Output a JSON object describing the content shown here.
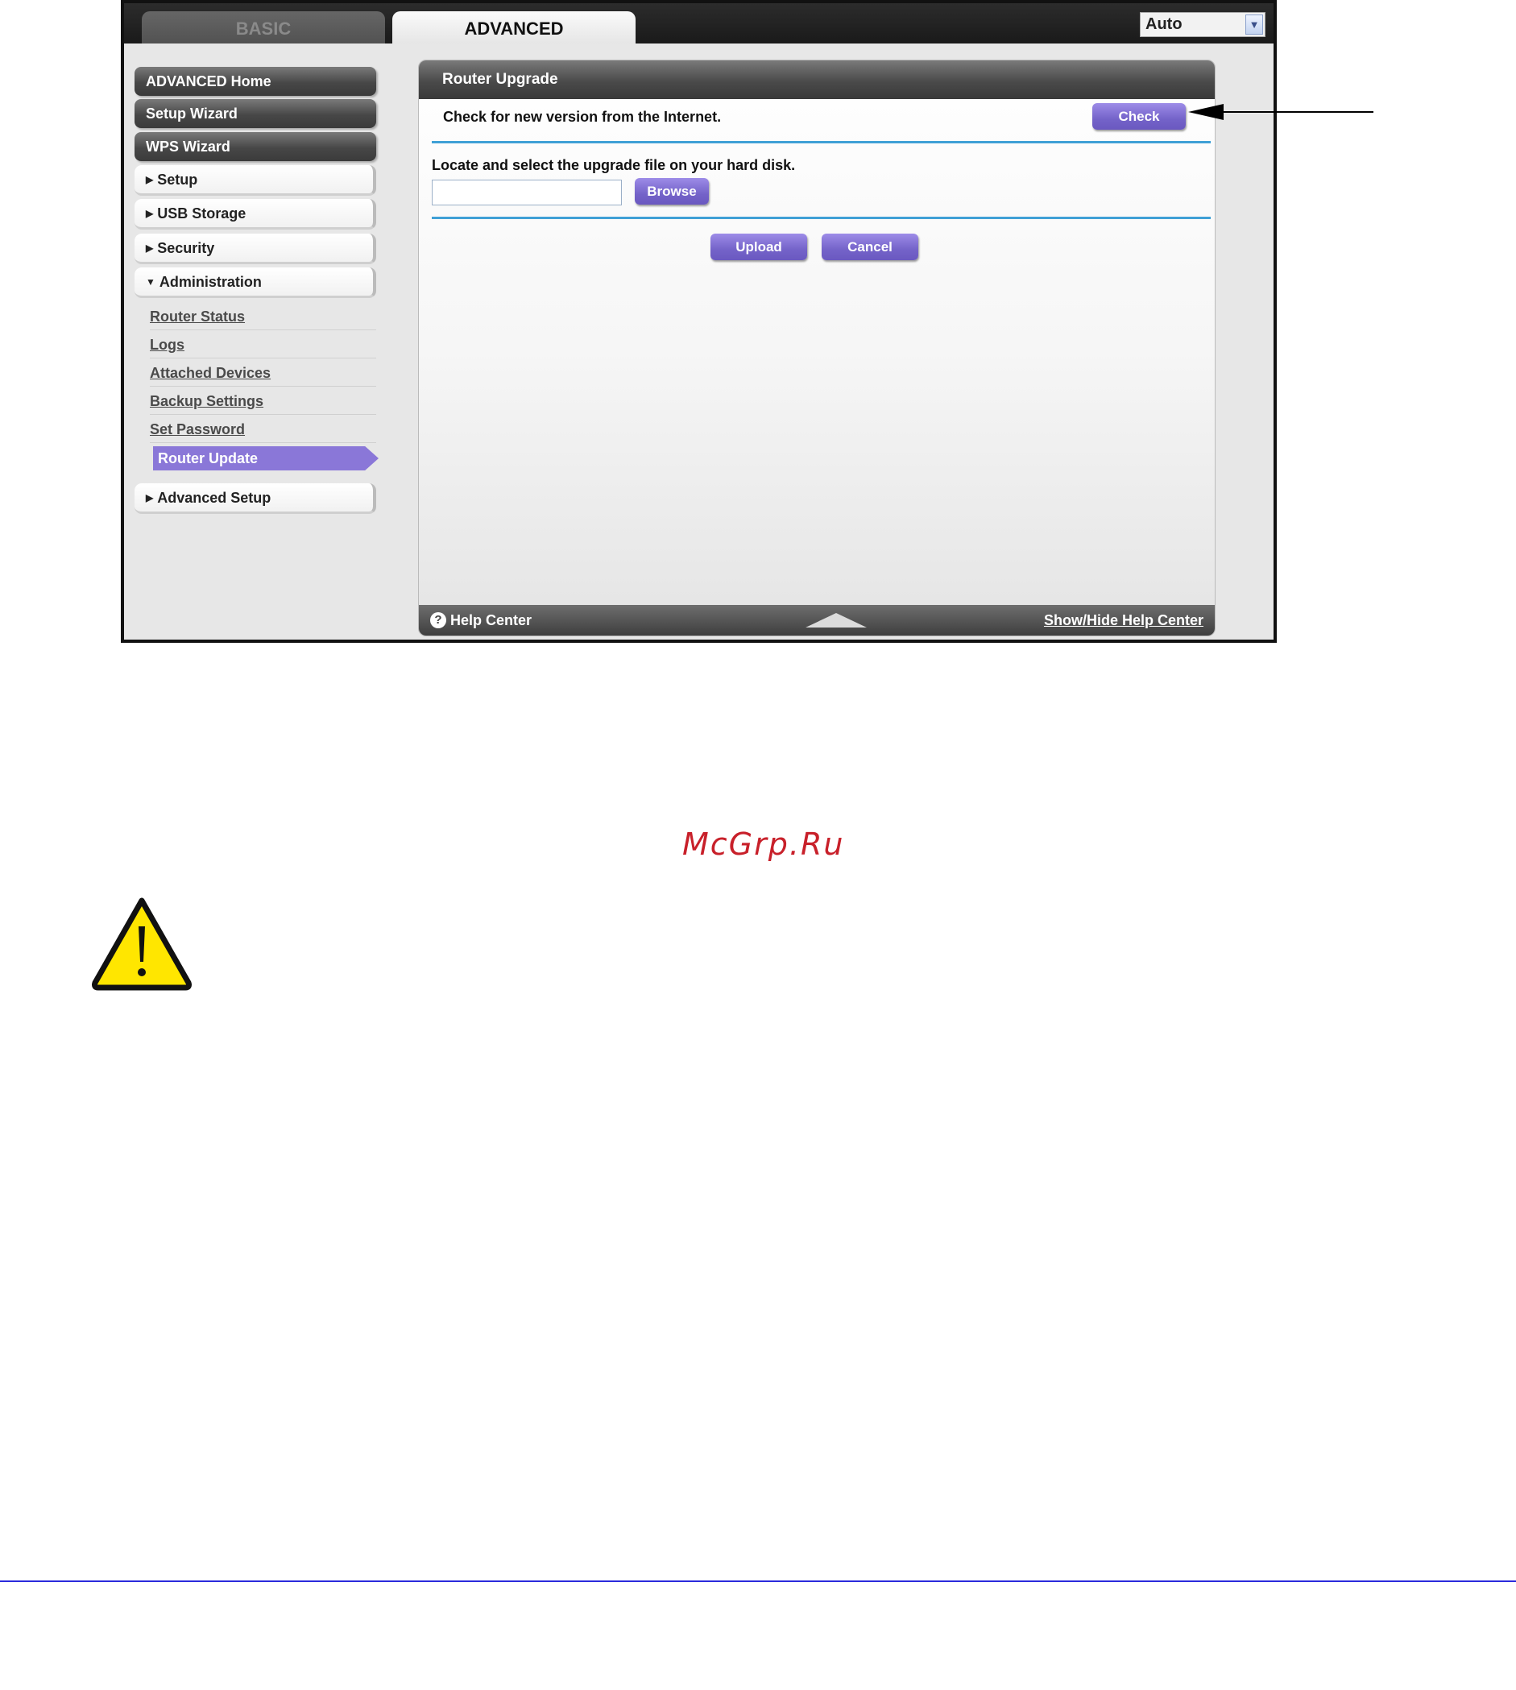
{
  "top_tabs": {
    "basic": "BASIC",
    "advanced": "ADVANCED"
  },
  "language_select": {
    "value": "Auto"
  },
  "sidebar": {
    "advanced_home": "ADVANCED Home",
    "setup_wizard": "Setup Wizard",
    "wps_wizard": "WPS Wizard",
    "setup": "Setup",
    "usb_storage": "USB Storage",
    "security": "Security",
    "administration": "Administration",
    "admin_items": [
      "Router Status",
      "Logs",
      "Attached Devices",
      "Backup Settings",
      "Set Password",
      "Router Update"
    ],
    "advanced_setup": "Advanced Setup"
  },
  "panel": {
    "title": "Router Upgrade",
    "check_label": "Check for new version from the Internet.",
    "check_button": "Check",
    "locate_label": "Locate and select the upgrade file on your hard disk.",
    "file_value": "",
    "browse_button": "Browse",
    "upload_button": "Upload",
    "cancel_button": "Cancel"
  },
  "footer": {
    "help_center": "Help Center",
    "show_hide": "Show/Hide Help Center"
  },
  "watermark": "McGrp.Ru",
  "colors": {
    "accent_purple": "#7463c9",
    "divider_blue": "#3fa0d6",
    "warning_yellow": "#ffe600"
  }
}
